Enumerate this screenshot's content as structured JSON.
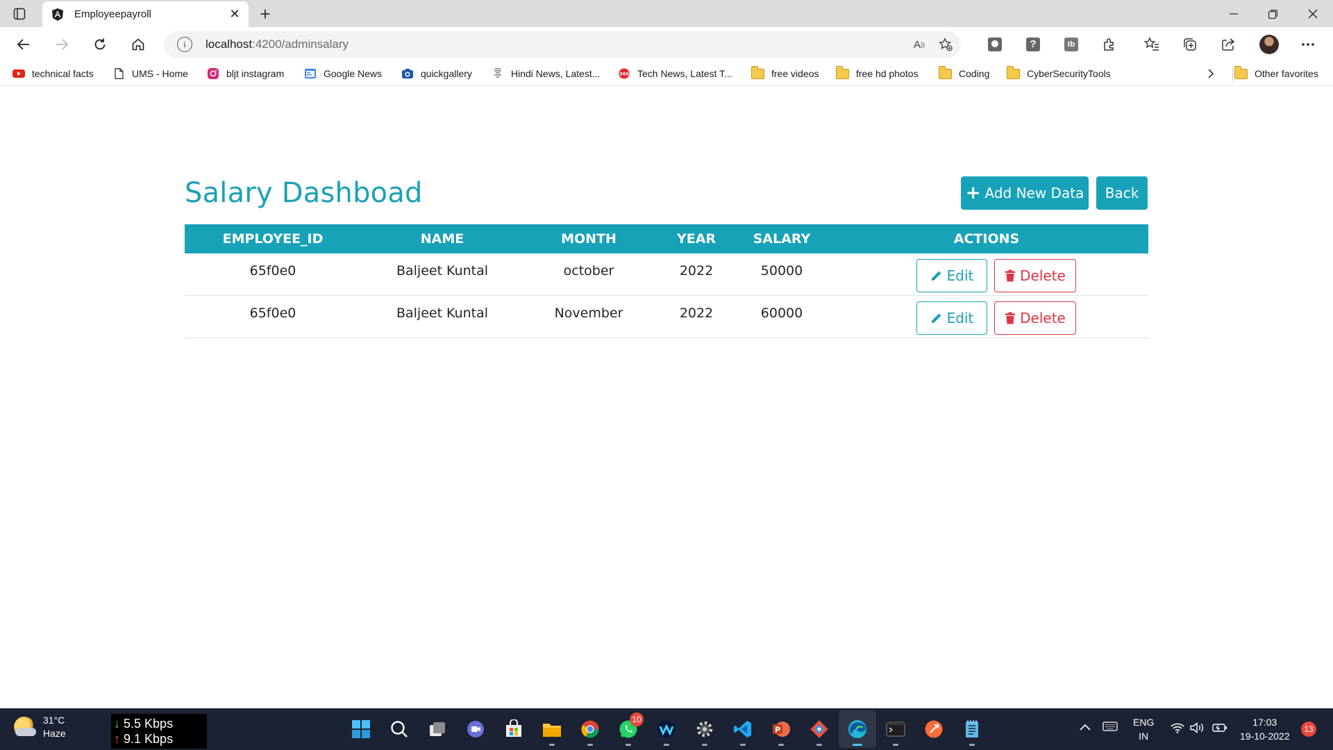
{
  "browser": {
    "tab_title": "Employeepayroll",
    "url_host": "localhost",
    "url_path": ":4200/adminsalary",
    "favorites": [
      {
        "label": "technical facts",
        "icon": "youtube-icon"
      },
      {
        "label": "UMS - Home",
        "icon": "page-icon"
      },
      {
        "label": "bljt instagram",
        "icon": "instagram-icon"
      },
      {
        "label": "Google News",
        "icon": "google-news-icon"
      },
      {
        "label": "quickgallery",
        "icon": "camera-icon"
      },
      {
        "label": "Hindi News, Latest...",
        "icon": "news-icon"
      },
      {
        "label": "Tech News, Latest T...",
        "icon": "tech360-icon"
      },
      {
        "label": "free videos",
        "icon": "folder-icon"
      },
      {
        "label": "free hd photos",
        "icon": "folder-icon"
      },
      {
        "label": "Coding",
        "icon": "folder-icon"
      },
      {
        "label": "CyberSecurityTools",
        "icon": "folder-icon"
      }
    ],
    "other_favorites": "Other favorites"
  },
  "page": {
    "title": "Salary Dashboad",
    "add_button": "Add New Data",
    "back_button": "Back",
    "columns": [
      "EMPLOYEE_ID",
      "NAME",
      "MONTH",
      "YEAR",
      "SALARY",
      "ACTIONS"
    ],
    "rows": [
      {
        "employee_id": "65f0e0",
        "name": "Baljeet Kuntal",
        "month": "october",
        "year": "2022",
        "salary": "50000"
      },
      {
        "employee_id": "65f0e0",
        "name": "Baljeet Kuntal",
        "month": "November",
        "year": "2022",
        "salary": "60000"
      }
    ],
    "edit_label": "Edit",
    "delete_label": "Delete"
  },
  "taskbar": {
    "temperature": "31°C",
    "weather": "Haze",
    "download_speed": "5.5 Kbps",
    "upload_speed": "9.1 Kbps",
    "whatsapp_badge": "10",
    "language": "ENG",
    "region": "IN",
    "time": "17:03",
    "date": "19-10-2022",
    "notification_count": "13"
  },
  "colors": {
    "accent": "#17a2b8",
    "danger": "#dc3545",
    "title": "#1aa1b8"
  }
}
